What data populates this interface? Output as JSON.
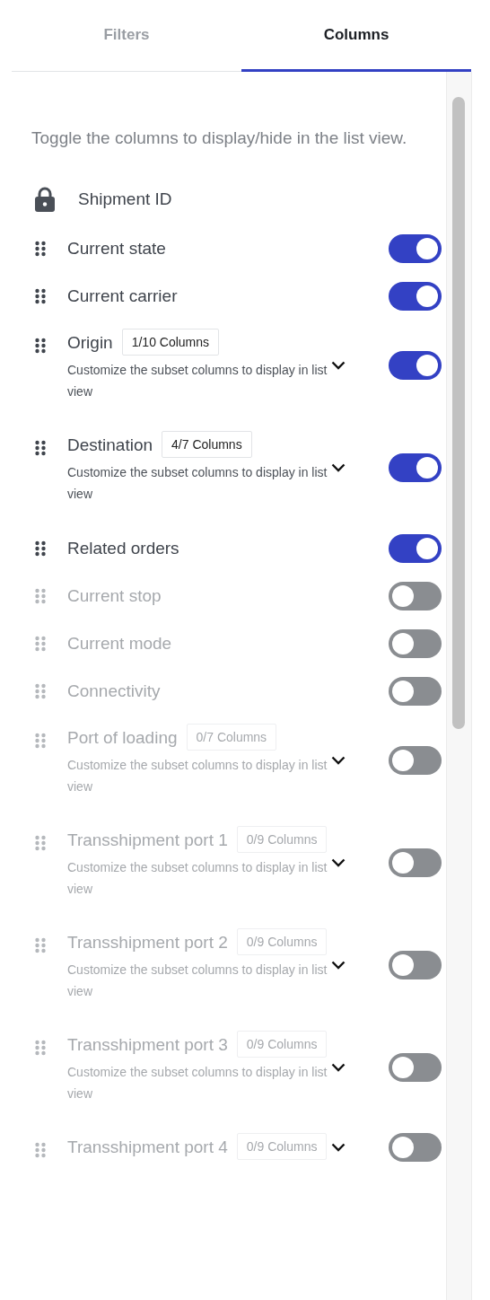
{
  "tabs": [
    {
      "label": "Filters",
      "selected": false
    },
    {
      "label": "Columns",
      "selected": true
    }
  ],
  "description": "Toggle the columns to display/hide in the list view.",
  "locked_column": {
    "label": "Shipment ID"
  },
  "columns": [
    {
      "kind": "simple",
      "label": "Current state",
      "on": true
    },
    {
      "kind": "simple",
      "label": "Current carrier",
      "on": true
    },
    {
      "kind": "group",
      "label": "Origin",
      "badge": "1/10 Columns",
      "subtitle": "Customize the subset columns to display in list view",
      "on": true
    },
    {
      "kind": "group",
      "label": "Destination",
      "badge": "4/7 Columns",
      "subtitle": "Customize the subset columns to display in list view",
      "on": true
    },
    {
      "kind": "simple",
      "label": "Related orders",
      "on": true
    },
    {
      "kind": "simple",
      "label": "Current stop",
      "on": false
    },
    {
      "kind": "simple",
      "label": "Current mode",
      "on": false
    },
    {
      "kind": "simple",
      "label": "Connectivity",
      "on": false
    },
    {
      "kind": "group",
      "label": "Port of loading",
      "badge": "0/7 Columns",
      "subtitle": "Customize the subset columns to display in list view",
      "on": false
    },
    {
      "kind": "group",
      "label": "Transshipment port 1",
      "badge": "0/9 Columns",
      "subtitle": "Customize the subset columns to display in list view",
      "on": false
    },
    {
      "kind": "group",
      "label": "Transshipment port 2",
      "badge": "0/9 Columns",
      "subtitle": "Customize the subset columns to display in list view",
      "on": false
    },
    {
      "kind": "group",
      "label": "Transshipment port 3",
      "badge": "0/9 Columns",
      "subtitle": "Customize the subset columns to display in list view",
      "on": false
    },
    {
      "kind": "group",
      "label": "Transshipment port 4",
      "badge": "0/9 Columns",
      "on": false
    }
  ]
}
